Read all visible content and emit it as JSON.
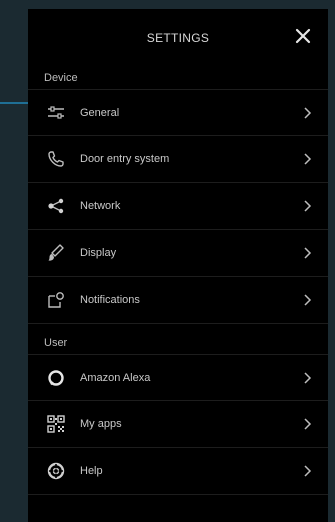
{
  "header": {
    "title": "SETTINGS"
  },
  "device": {
    "label": "Device",
    "items": [
      {
        "label": "General",
        "icon": "sliders-icon"
      },
      {
        "label": "Door entry system",
        "icon": "phone-icon"
      },
      {
        "label": "Network",
        "icon": "network-icon"
      },
      {
        "label": "Display",
        "icon": "brush-icon"
      },
      {
        "label": "Notifications",
        "icon": "notification-icon"
      }
    ]
  },
  "user": {
    "label": "User",
    "items": [
      {
        "label": "Amazon Alexa",
        "icon": "alexa-icon"
      },
      {
        "label": "My apps",
        "icon": "qr-apps-icon"
      },
      {
        "label": "Help",
        "icon": "help-icon"
      }
    ]
  },
  "colors": {
    "background": "#1b2a31",
    "panel": "#000000",
    "text": "#c9c9c9",
    "accent_line": "#1f6f95"
  }
}
